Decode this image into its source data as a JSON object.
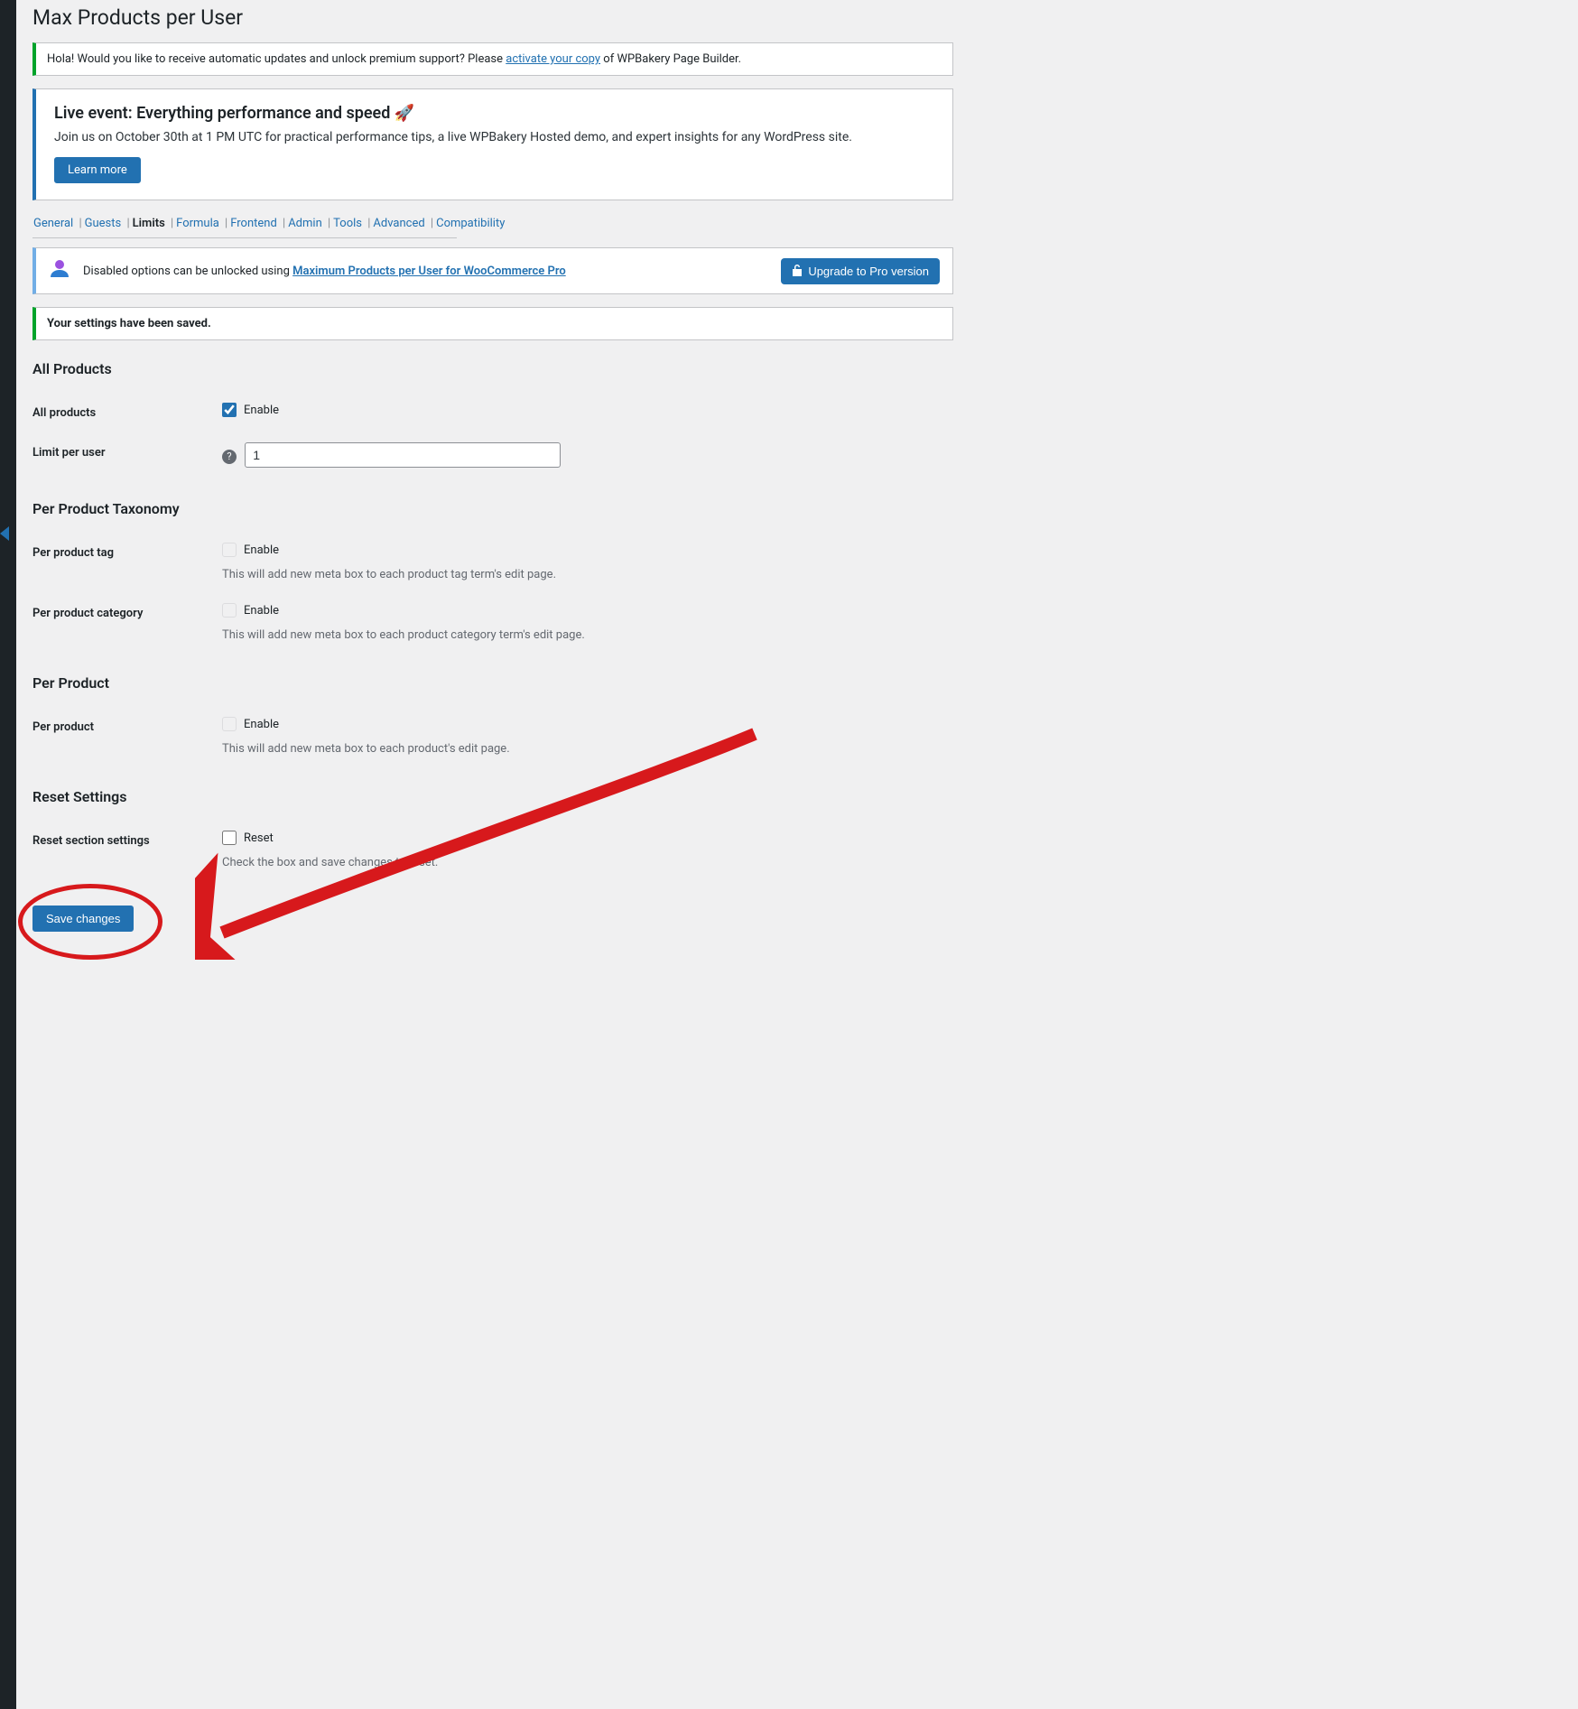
{
  "page": {
    "title": "Max Products per User"
  },
  "notices": {
    "activate_prefix": "Hola! Would you like to receive automatic updates and unlock premium support? Please ",
    "activate_link": "activate your copy",
    "activate_suffix": " of WPBakery Page Builder.",
    "saved": "Your settings have been saved."
  },
  "promo": {
    "title": "Live event: Everything performance and speed 🚀",
    "body": "Join us on October 30th at 1 PM UTC for practical performance tips, a live WPBakery Hosted demo, and expert insights for any WordPress site.",
    "button": "Learn more"
  },
  "tabs": {
    "items": [
      "General",
      "Guests",
      "Limits",
      "Formula",
      "Frontend",
      "Admin",
      "Tools",
      "Advanced",
      "Compatibility"
    ],
    "active_index": 2
  },
  "pro_banner": {
    "text_prefix": "Disabled options can be unlocked using ",
    "link": "Maximum Products per User for WooCommerce Pro",
    "button": "Upgrade to Pro version"
  },
  "sections": {
    "all_products": {
      "title": "All Products",
      "row_all": {
        "label": "All products",
        "check_label": "Enable",
        "checked": true
      },
      "row_limit": {
        "label": "Limit per user",
        "value": "1"
      }
    },
    "per_taxonomy": {
      "title": "Per Product Taxonomy",
      "tag": {
        "label": "Per product tag",
        "check_label": "Enable",
        "checked": false,
        "desc": "This will add new meta box to each product tag term's edit page."
      },
      "category": {
        "label": "Per product category",
        "check_label": "Enable",
        "checked": false,
        "desc": "This will add new meta box to each product category term's edit page."
      }
    },
    "per_product": {
      "title": "Per Product",
      "row": {
        "label": "Per product",
        "check_label": "Enable",
        "checked": false,
        "desc": "This will add new meta box to each product's edit page."
      }
    },
    "reset": {
      "title": "Reset Settings",
      "row": {
        "label": "Reset section settings",
        "check_label": "Reset",
        "checked": false,
        "desc": "Check the box and save changes to reset."
      }
    }
  },
  "actions": {
    "save": "Save changes"
  }
}
